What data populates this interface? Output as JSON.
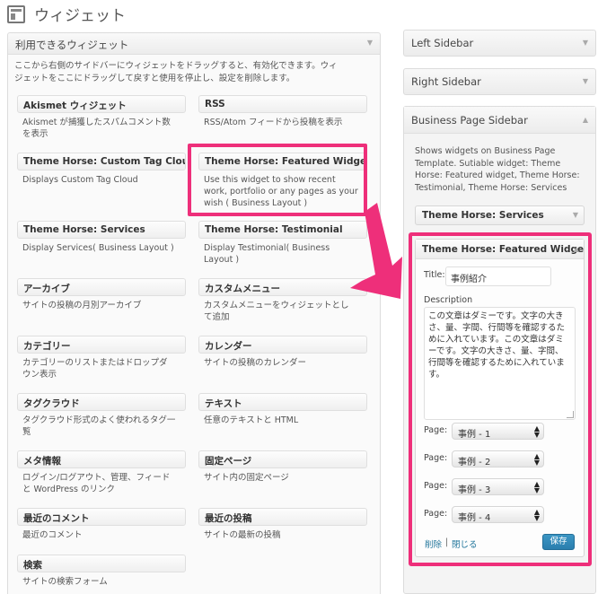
{
  "page": {
    "title": "ウィジェット"
  },
  "available": {
    "header": "利用できるウィジェット",
    "description_line1": "ここから右側のサイドバーにウィジェットをドラッグすると、有効化できます。ウィ",
    "description_line2": "ジェットをここにドラッグして戻すと使用を停止し、設定を削除します。",
    "widgets": [
      {
        "title": "Akismet ウィジェット",
        "desc": [
          "Akismet が捕獲したスパムコメント数",
          "を表示"
        ]
      },
      {
        "title": "RSS",
        "desc": [
          "RSS/Atom フィードから投稿を表示"
        ]
      },
      {
        "title": "Theme Horse: Custom Tag Cloud",
        "desc": [
          "Displays Custom Tag Cloud"
        ]
      },
      {
        "title": "Theme Horse: Featured Widget",
        "desc": [
          "Use this widget to show recent",
          "work, portfolio or any pages as your",
          "wish ( Business Layout )"
        ]
      },
      {
        "title": "Theme Horse: Services",
        "desc": [
          "Display Services( Business Layout )"
        ]
      },
      {
        "title": "Theme Horse: Testimonial",
        "desc": [
          "Display Testimonial( Business",
          "Layout )"
        ]
      },
      {
        "title": "アーカイブ",
        "desc": [
          "サイトの投稿の月別アーカイブ"
        ]
      },
      {
        "title": "カスタムメニュー",
        "desc": [
          "カスタムメニューをウィジェットとし",
          "て追加"
        ]
      },
      {
        "title": "カテゴリー",
        "desc": [
          "カテゴリーのリストまたはドロップダ",
          "ウン表示"
        ]
      },
      {
        "title": "カレンダー",
        "desc": [
          "サイトの投稿のカレンダー"
        ]
      },
      {
        "title": "タグクラウド",
        "desc": [
          "タグクラウド形式のよく使われるタグ一",
          "覧"
        ]
      },
      {
        "title": "テキスト",
        "desc": [
          "任意のテキストと HTML"
        ]
      },
      {
        "title": "メタ情報",
        "desc": [
          "ログイン/ログアウト、管理、フィード",
          "と WordPress のリンク"
        ]
      },
      {
        "title": "固定ページ",
        "desc": [
          "サイト内の固定ページ"
        ]
      },
      {
        "title": "最近のコメント",
        "desc": [
          "最近のコメント"
        ]
      },
      {
        "title": "最近の投稿",
        "desc": [
          "サイトの最新の投稿"
        ]
      },
      {
        "title": "検索",
        "desc": [
          "サイトの検索フォーム"
        ]
      }
    ]
  },
  "sidebars": {
    "left": "Left Sidebar",
    "right": "Right Sidebar",
    "business": {
      "title": "Business Page Sidebar",
      "desc": [
        "Shows widgets on Business Page",
        "Template. Sutiable widget: Theme",
        "Horse: Featured widget, Theme Horse:",
        "Testimonial, Theme Horse: Services"
      ],
      "services_widget": "Theme Horse: Services",
      "featured_widget": {
        "title": "Theme Horse: Featured Widget",
        "title_label": "Title:",
        "title_value": "事例紹介",
        "description_label": "Description",
        "description_lines": [
          "この文章はダミーです。文字の大き",
          "さ、量、字間、行間等を確認するた",
          "めに入れています。この文章はダミ",
          "ーです。文字の大きさ、量、字間、",
          "行間等を確認するために入れていま",
          "す。"
        ],
        "page_label": "Page:",
        "pages": [
          "事例 - 1",
          "事例 - 2",
          "事例 - 3",
          "事例 - 4"
        ],
        "delete": "削除",
        "separator": "|",
        "close": "閉じる",
        "save": "保存"
      }
    }
  },
  "colors": {
    "highlight": "#ee2f7a",
    "link": "#21759b",
    "save_button": "#2a7eae"
  }
}
